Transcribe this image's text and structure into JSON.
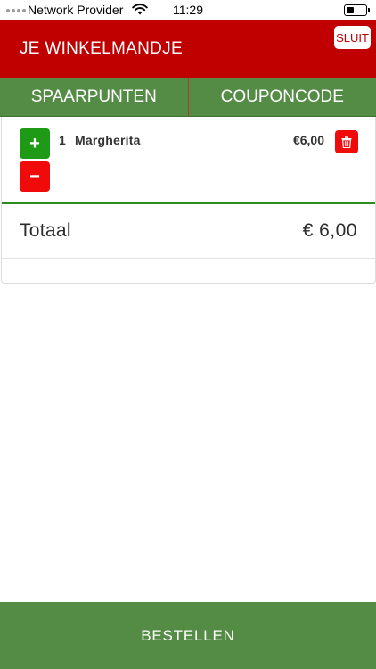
{
  "status_bar": {
    "carrier": "Network Provider",
    "time": "11:29"
  },
  "header": {
    "title": "JE WINKELMANDJE",
    "close_label": "SLUIT"
  },
  "tabs": [
    {
      "label": "SPAARPUNTEN"
    },
    {
      "label": "COUPONCODE"
    }
  ],
  "cart": {
    "items": [
      {
        "quantity": "1",
        "name": "Margherita",
        "price": "€6,00"
      }
    ],
    "plus_label": "+",
    "minus_label": "−",
    "total_label": "Totaal",
    "total_amount": "€ 6,00"
  },
  "footer": {
    "order_label": "BESTELLEN"
  },
  "colors": {
    "header_red": "#c00000",
    "tab_green": "#548c46",
    "plus_green": "#1f9a16",
    "minus_red": "#f00a0a"
  }
}
